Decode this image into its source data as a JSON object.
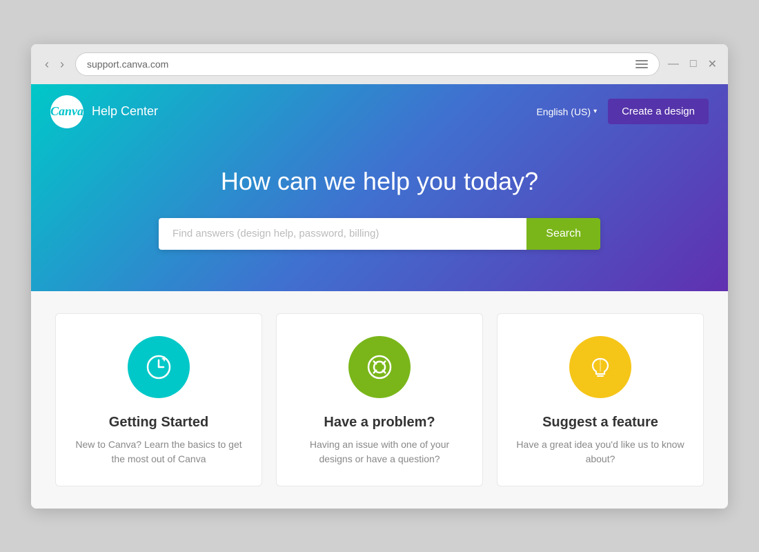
{
  "browser": {
    "address": "support.canva.com",
    "nav_back": "‹",
    "nav_forward": "›",
    "minimize": "—",
    "maximize": "□",
    "close": "✕"
  },
  "header": {
    "logo_text": "Canva",
    "help_center_label": "Help Center",
    "lang_label": "English (US)",
    "create_btn_label": "Create a design"
  },
  "hero": {
    "title": "How can we help you today?",
    "search_placeholder": "Find answers (design help, password, billing)",
    "search_btn_label": "Search"
  },
  "cards": [
    {
      "id": "getting-started",
      "title": "Getting Started",
      "description": "New to Canva? Learn the basics to get the most out of Canva",
      "icon_color": "teal",
      "icon_type": "clock"
    },
    {
      "id": "have-a-problem",
      "title": "Have a problem?",
      "description": "Having an issue with one of your designs or have a question?",
      "icon_color": "green",
      "icon_type": "lifebuoy"
    },
    {
      "id": "suggest-feature",
      "title": "Suggest a feature",
      "description": "Have a great idea you'd like us to know about?",
      "icon_color": "yellow",
      "icon_type": "lightbulb"
    }
  ]
}
